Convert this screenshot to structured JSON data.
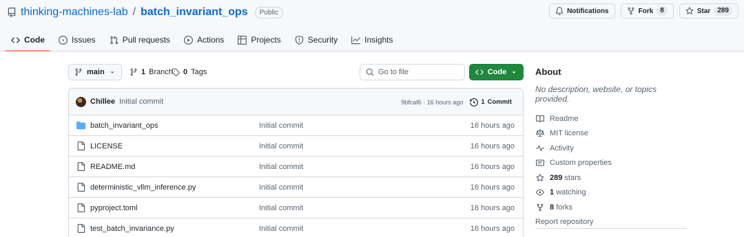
{
  "repo": {
    "owner": "thinking-machines-lab",
    "separator": "/",
    "name": "batch_invariant_ops",
    "visibility": "Public"
  },
  "actions": {
    "notifications_label": "Notifications",
    "fork_label": "Fork",
    "fork_count": "8",
    "star_label": "Star",
    "star_count": "289"
  },
  "tabs": [
    {
      "label": "Code",
      "icon": "code-icon",
      "selected": true
    },
    {
      "label": "Issues",
      "icon": "issue-icon"
    },
    {
      "label": "Pull requests",
      "icon": "pull-request-icon"
    },
    {
      "label": "Actions",
      "icon": "play-icon"
    },
    {
      "label": "Projects",
      "icon": "table-icon"
    },
    {
      "label": "Security",
      "icon": "shield-icon"
    },
    {
      "label": "Insights",
      "icon": "graph-icon"
    }
  ],
  "toolbar": {
    "branch": "main",
    "branches_count": "1",
    "branches_label": "Branch",
    "tags_count": "0",
    "tags_label": "Tags",
    "search_placeholder": "Go to file",
    "code_label": "Code"
  },
  "latest_commit": {
    "author": "Chillee",
    "message": "Initial commit",
    "meta": "9bfcaf6 · 16 hours ago",
    "commits_count": "1",
    "commits_label": "Commit"
  },
  "files": [
    {
      "name": "batch_invariant_ops",
      "type": "folder",
      "commit": "Initial commit",
      "date": "16 hours ago"
    },
    {
      "name": "LICENSE",
      "type": "file",
      "commit": "Initial commit",
      "date": "16 hours ago"
    },
    {
      "name": "README.md",
      "type": "file",
      "commit": "Initial commit",
      "date": "16 hours ago"
    },
    {
      "name": "deterministic_vllm_inference.py",
      "type": "file",
      "commit": "Initial commit",
      "date": "16 hours ago"
    },
    {
      "name": "pyproject.toml",
      "type": "file",
      "commit": "Initial commit",
      "date": "16 hours ago"
    },
    {
      "name": "test_batch_invariance.py",
      "type": "file",
      "commit": "Initial commit",
      "date": "16 hours ago"
    }
  ],
  "about": {
    "title": "About",
    "description": "No description, website, or topics provided.",
    "readme": "Readme",
    "license": "MIT license",
    "activity": "Activity",
    "custom_properties": "Custom properties",
    "stars_count": "289",
    "stars_label": "stars",
    "watching_count": "1",
    "watching_label": "watching",
    "forks_count": "8",
    "forks_label": "forks",
    "report": "Report repository"
  },
  "colors": {
    "accent_link": "#0969da",
    "code_button": "#1f883d",
    "folder": "#54aeff",
    "tab_underline": "#fd8c73"
  }
}
